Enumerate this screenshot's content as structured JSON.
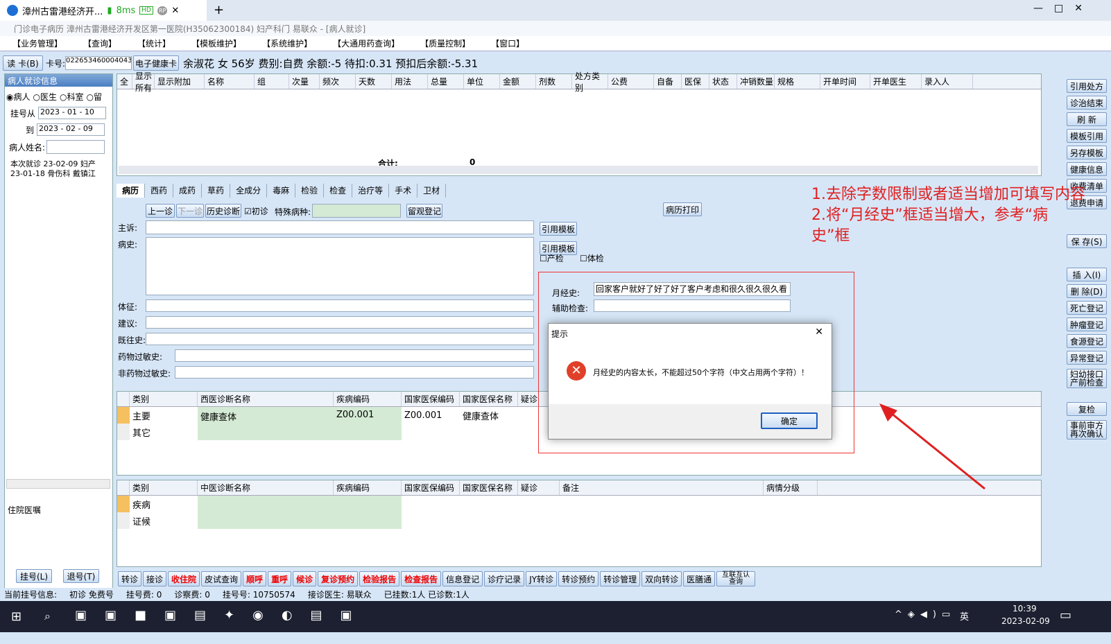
{
  "browser": {
    "tab_title": "漳州古雷港经济开...",
    "ping": "8ms",
    "hd": "HD",
    "rp": "RP",
    "plus": "+",
    "close": "✕"
  },
  "window": {
    "title": "门诊电子病历  漳州古雷港经济开发区第一医院(H35062300184)  妇产科门  易联众 - [病人就诊]"
  },
  "menu": [
    "【业务管理】",
    "【查询】",
    "【统计】",
    "【模板维护】",
    "【系统维护】",
    "【大通用药查询】",
    "【质量控制】",
    "【窗口】"
  ],
  "patient": {
    "read_card": "读 卡(B)",
    "card_label": "卡号:",
    "card_no": "022653460004043(",
    "ehc": "电子健康卡",
    "info": "余淑花 女 56岁 费别:自费 余额:-5 待扣:0.31 预扣后余额:-5.31"
  },
  "left": {
    "header": "病人就诊信息",
    "radios": [
      "病人",
      "医生",
      "科室",
      "留"
    ],
    "from_label": "挂号从",
    "from_date": "2023 - 01 - 10",
    "to_label": "到",
    "to_date": "2023 - 02 - 09",
    "name_label": "病人姓名:",
    "tree": [
      "本次就诊 23-02-09 妇产",
      "23-01-18 骨伤科 戴镇江"
    ],
    "hosp": "住院医嘱",
    "btn_reg": "挂号(L)",
    "btn_unreg": "退号(T)"
  },
  "rx": {
    "cols": [
      "全",
      "显示所有",
      "显示附加",
      "名称",
      "组",
      "次量",
      "频次",
      "天数",
      "用法",
      "总量",
      "单位",
      "金额",
      "剂数",
      "处方类别",
      "公费",
      "自备",
      "医保",
      "状态",
      "冲销数量",
      "规格",
      "开单时间",
      "开单医生",
      "录入人"
    ],
    "total_label": "合计:",
    "total_value": "0"
  },
  "right_buttons": [
    "引用处方",
    "诊治结束",
    "刷 新",
    "模板引用",
    "另存模板",
    "健康信息",
    "收费清单",
    "退费申请",
    "保 存(S)",
    "插 入(I)",
    "删 除(D)",
    "死亡登记",
    "肿瘤登记",
    "食源登记",
    "异常登记",
    "妇幼接口产前检查",
    "复检",
    "事前审方再次确认"
  ],
  "tabs": [
    "病历",
    "西药",
    "成药",
    "草药",
    "全成分",
    "毒麻",
    "检验",
    "检查",
    "治疗等",
    "手术",
    "卫材"
  ],
  "emr": {
    "prev": "上一诊",
    "next": "下一诊",
    "history": "历史诊断",
    "first": "初诊",
    "special": "特殊病种:",
    "obs": "留观登记",
    "print": "病历打印",
    "complaint": "主诉:",
    "history_label": "病史:",
    "sign": "体征:",
    "advice": "建议:",
    "past": "既往史:",
    "drug_allergy": "药物过敏史:",
    "nondrug_allergy": "非药物过敏史:",
    "tpl1": "引用模板",
    "tpl2": "引用模板",
    "prenatal": "产检",
    "physical": "体检",
    "menstrual_label": "月经史:",
    "menstrual_value": "回家客户就好了好了好了客户考虑和很久很久很久看",
    "aux_label": "辅助检查:"
  },
  "west": {
    "cols": [
      "类别",
      "西医诊断名称",
      "疾病编码",
      "国家医保编码",
      "国家医保名称",
      "疑诊"
    ],
    "rows": [
      [
        "主要",
        "健康查体",
        "Z00.001",
        "Z00.001",
        "健康查体"
      ],
      [
        "其它",
        "",
        "",
        "",
        ""
      ]
    ]
  },
  "tcm": {
    "cols": [
      "类别",
      "中医诊断名称",
      "疾病编码",
      "国家医保编码",
      "国家医保名称",
      "疑诊",
      "备注",
      "病情分级"
    ],
    "rows": [
      [
        "疾病"
      ],
      [
        "证候"
      ]
    ]
  },
  "dialog": {
    "title": "提示",
    "message": "月经史的内容太长，不能超过50个字符（中文占用两个字符）！",
    "ok": "确定",
    "close": "✕"
  },
  "annotation": {
    "line1": "1.去除字数限制或者适当增加可填写内容",
    "line2": "2.将“月经史”框适当增大，参考“病",
    "line3": "史”框"
  },
  "bottom": [
    "转诊",
    "接诊",
    "收住院",
    "皮试查询",
    "顺呼",
    "重呼",
    "候诊",
    "复诊预约",
    "检验报告",
    "检查报告",
    "信息登记",
    "诊疗记录",
    "JY转诊",
    "转诊预约",
    "转诊管理",
    "双向转诊",
    "医膳通",
    "互联互认查询"
  ],
  "status": [
    "当前挂号信息:",
    "初诊 免费号",
    "挂号费:  0",
    "诊察费: 0",
    "挂号号:  10750574",
    "接诊医生:  易联众",
    "已挂数:1人 已诊数:1人"
  ],
  "taskbar": {
    "time": "10:39",
    "date": "2023-02-09",
    "lang": "英"
  }
}
